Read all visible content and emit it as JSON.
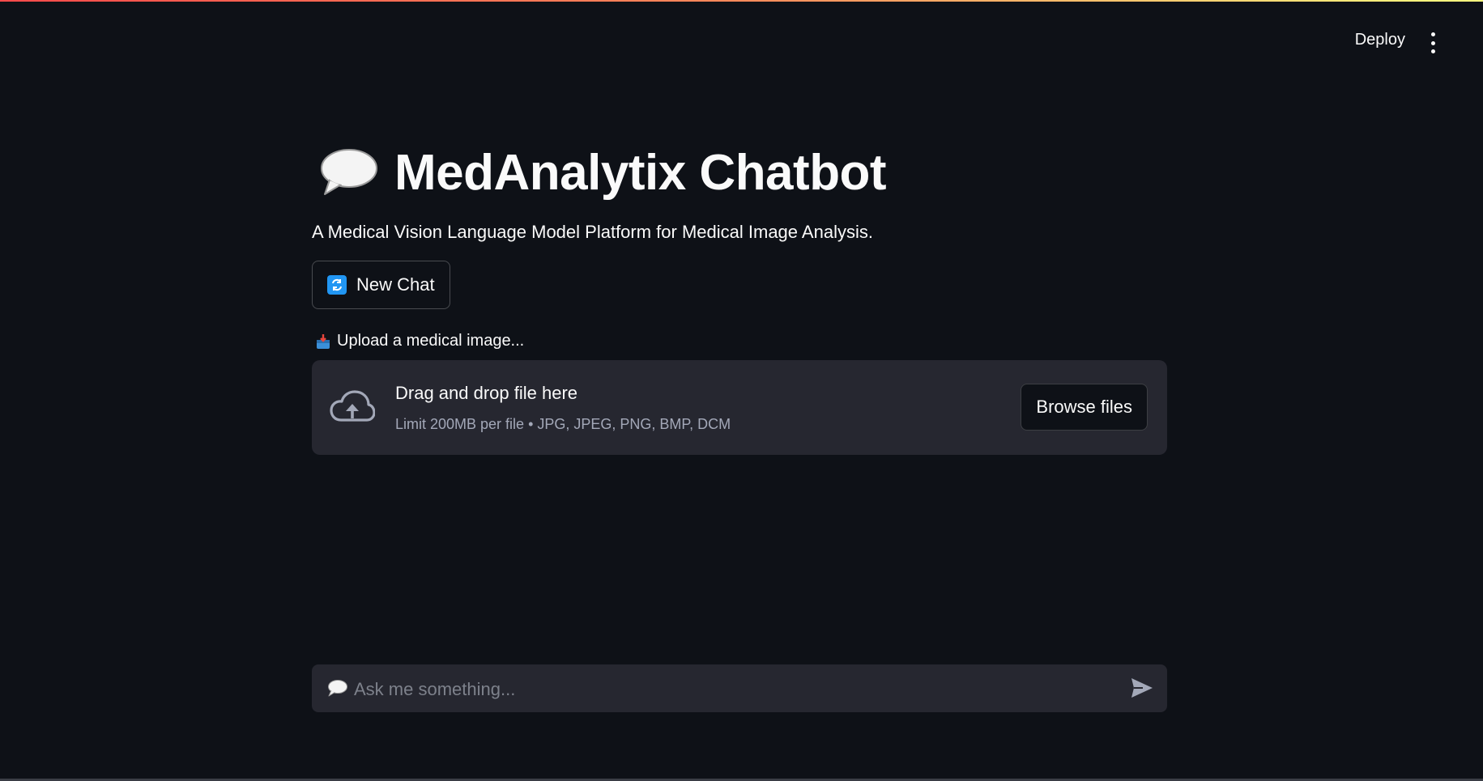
{
  "header": {
    "deploy_label": "Deploy",
    "menu_icon": "more-vertical-icon"
  },
  "main": {
    "title_icon": "speech-bubble-icon",
    "title": "MedAnalytix Chatbot",
    "subtitle": "A Medical Vision Language Model Platform for Medical Image Analysis.",
    "new_chat": {
      "icon": "refresh-icon",
      "label": "New Chat"
    },
    "uploader": {
      "icon": "inbox-tray-icon",
      "label": "Upload a medical image...",
      "dropzone_icon": "cloud-upload-icon",
      "dropzone_title": "Drag and drop file here",
      "dropzone_subtitle": "Limit 200MB per file • JPG, JPEG, PNG, BMP, DCM",
      "browse_label": "Browse files"
    }
  },
  "chat": {
    "icon": "speech-bubble-icon",
    "placeholder": "Ask me something...",
    "send_icon": "send-icon"
  },
  "colors": {
    "background": "#0e1117",
    "surface": "#262730",
    "text": "#fafafa",
    "muted": "#a3a8b8",
    "accent_blue": "#2196f3"
  }
}
